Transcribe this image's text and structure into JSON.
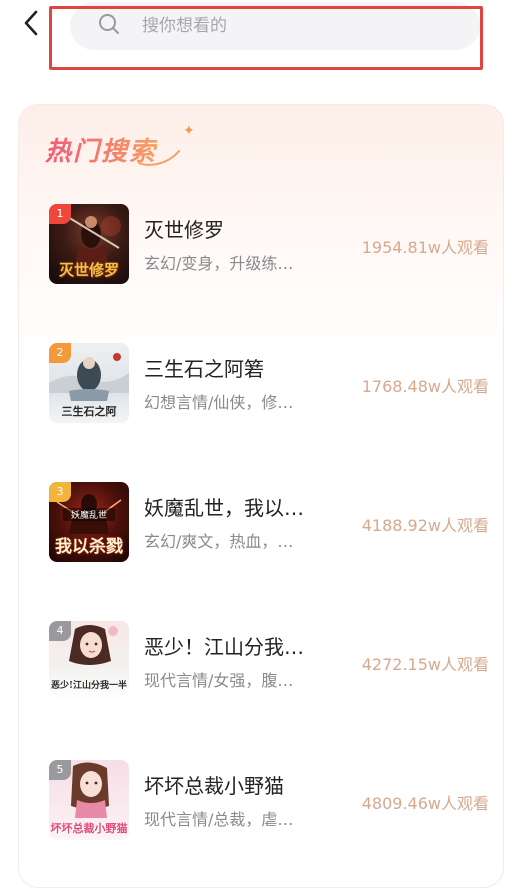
{
  "search": {
    "placeholder": "搜你想看的"
  },
  "hot": {
    "title": "热门搜索",
    "items": [
      {
        "rank": "1",
        "title": "灭世修罗",
        "desc": "玄幻/变身，升级练…",
        "views": "1954.81w人观看",
        "cover_text": "灭世修罗",
        "badge_color": "#f0473d"
      },
      {
        "rank": "2",
        "title": "三生石之阿箬",
        "desc": "幻想言情/仙侠，修…",
        "views": "1768.48w人观看",
        "cover_text": "三生石之阿",
        "badge_color": "#f29a3a"
      },
      {
        "rank": "3",
        "title": "妖魔乱世，我以…",
        "desc": "玄幻/爽文，热血，…",
        "views": "4188.92w人观看",
        "cover_text": "我以杀戮",
        "cover_top": "妖魔乱世",
        "badge_color": "#f2b43a"
      },
      {
        "rank": "4",
        "title": "恶少！江山分我…",
        "desc": "现代言情/女强，腹…",
        "views": "4272.15w人观看",
        "cover_text": "恶少!江山分我一半",
        "badge_color": "#9a9a9e"
      },
      {
        "rank": "5",
        "title": "坏坏总裁小野猫",
        "desc": "现代言情/总裁，虐…",
        "views": "4809.46w人观看",
        "cover_text": "坏坏总裁小野猫",
        "badge_color": "#9a9a9e"
      }
    ]
  }
}
